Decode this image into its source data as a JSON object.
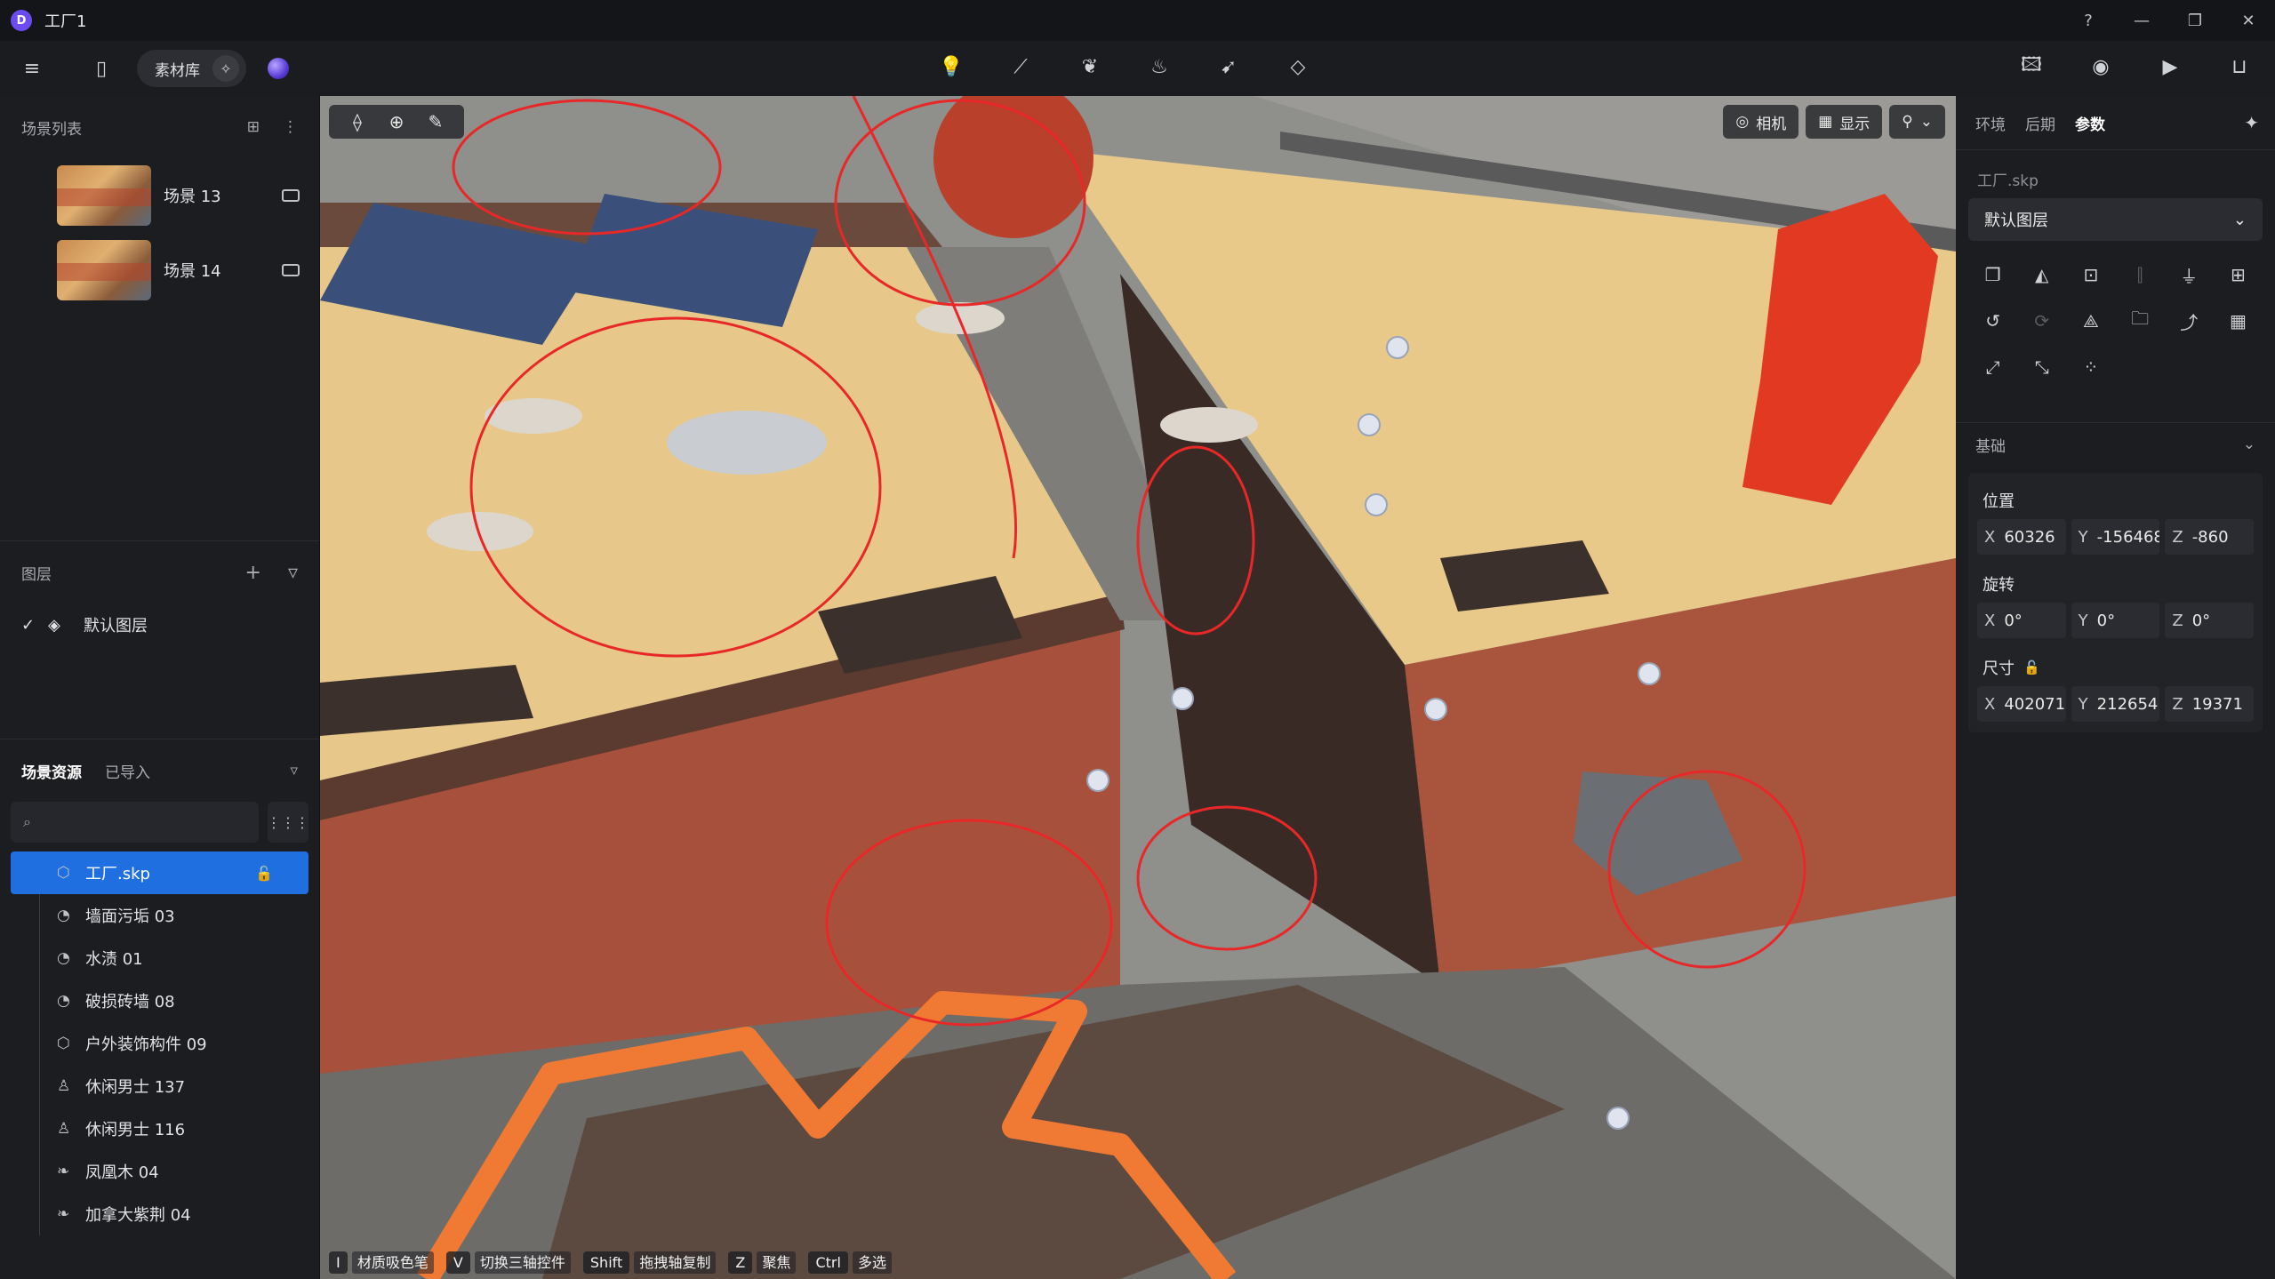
{
  "window": {
    "title": "工厂1",
    "logo": "D"
  },
  "toolbar": {
    "library_label": "素材库"
  },
  "scene_list": {
    "title": "场景列表",
    "items": [
      {
        "name": "场景 13"
      },
      {
        "name": "场景 14"
      }
    ]
  },
  "layers": {
    "title": "图层",
    "items": [
      {
        "name": "默认图层"
      }
    ]
  },
  "assets": {
    "tab_scene": "场景资源",
    "tab_imported": "已导入",
    "items": [
      {
        "name": "工厂.skp",
        "icon": "cube-icon"
      },
      {
        "name": "墙面污垢 03",
        "icon": "material-icon"
      },
      {
        "name": "水渍 01",
        "icon": "material-icon"
      },
      {
        "name": "破损砖墙 08",
        "icon": "material-icon"
      },
      {
        "name": "户外装饰构件 09",
        "icon": "cube-icon"
      },
      {
        "name": "休闲男士 137",
        "icon": "person-icon"
      },
      {
        "name": "休闲男士 116",
        "icon": "person-icon"
      },
      {
        "name": "凤凰木 04",
        "icon": "leaf-icon"
      },
      {
        "name": "加拿大紫荆 04",
        "icon": "leaf-icon"
      }
    ]
  },
  "viewport": {
    "camera_label": "相机",
    "display_label": "显示",
    "hints": [
      {
        "key": "I",
        "text": "材质吸色笔"
      },
      {
        "key": "V",
        "text": "切换三轴控件"
      },
      {
        "key": "Shift",
        "text": "拖拽轴复制"
      },
      {
        "key": "Z",
        "text": "聚焦"
      },
      {
        "key": "Ctrl",
        "text": "多选"
      }
    ]
  },
  "right_panel": {
    "tabs": [
      "环境",
      "后期",
      "参数"
    ],
    "active_tab": "参数",
    "file_name": "工厂.skp",
    "layer_select": "默认图层",
    "basic_title": "基础",
    "position": {
      "title": "位置",
      "x": "60326",
      "y": "-156468",
      "z": "-860"
    },
    "rotation": {
      "title": "旋转",
      "x": "0°",
      "y": "0°",
      "z": "0°"
    },
    "size": {
      "title": "尺寸",
      "x": "402071",
      "y": "212654",
      "z": "19371"
    }
  },
  "colors": {
    "accent": "#1f6fe0",
    "annotation": "#e82828",
    "rooftop": "#e9c98a",
    "brick": "#a7513c"
  }
}
